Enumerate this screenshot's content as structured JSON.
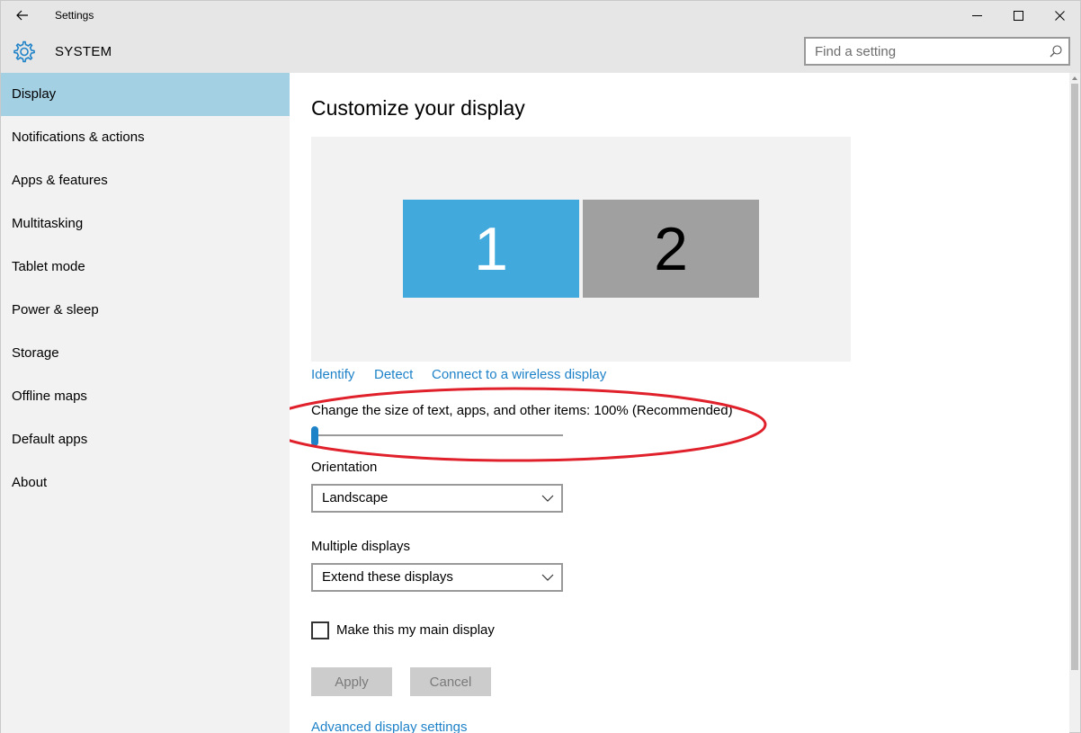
{
  "window": {
    "title": "Settings",
    "controls": [
      "minimize",
      "maximize",
      "close"
    ]
  },
  "header": {
    "section_title": "SYSTEM",
    "icon": "gear-icon",
    "search": {
      "placeholder": "Find a setting",
      "value": ""
    }
  },
  "sidebar": {
    "items": [
      {
        "label": "Display",
        "active": true
      },
      {
        "label": "Notifications & actions"
      },
      {
        "label": "Apps & features"
      },
      {
        "label": "Multitasking"
      },
      {
        "label": "Tablet mode"
      },
      {
        "label": "Power & sleep"
      },
      {
        "label": "Storage"
      },
      {
        "label": "Offline maps"
      },
      {
        "label": "Default apps"
      },
      {
        "label": "About"
      }
    ]
  },
  "main": {
    "title": "Customize your display",
    "monitors": [
      {
        "number": "1",
        "selected": true,
        "color": "#41a9dc"
      },
      {
        "number": "2",
        "selected": false,
        "color": "#a0a0a0"
      }
    ],
    "links": {
      "identify": "Identify",
      "detect": "Detect",
      "wireless": "Connect to a wireless display"
    },
    "scale": {
      "label": "Change the size of text, apps, and other items: 100% (Recommended)",
      "slider_value": 0.0
    },
    "orientation": {
      "label": "Orientation",
      "selected": "Landscape"
    },
    "multiple_displays": {
      "label": "Multiple displays",
      "selected": "Extend these displays"
    },
    "main_display_checkbox": {
      "label": "Make this my main display",
      "checked": false
    },
    "buttons": {
      "apply": "Apply",
      "cancel": "Cancel"
    },
    "advanced_link": "Advanced display settings"
  },
  "colors": {
    "accent": "#1e82c8",
    "active_nav": "#a4d0e4",
    "annotation": "#e0202a"
  }
}
